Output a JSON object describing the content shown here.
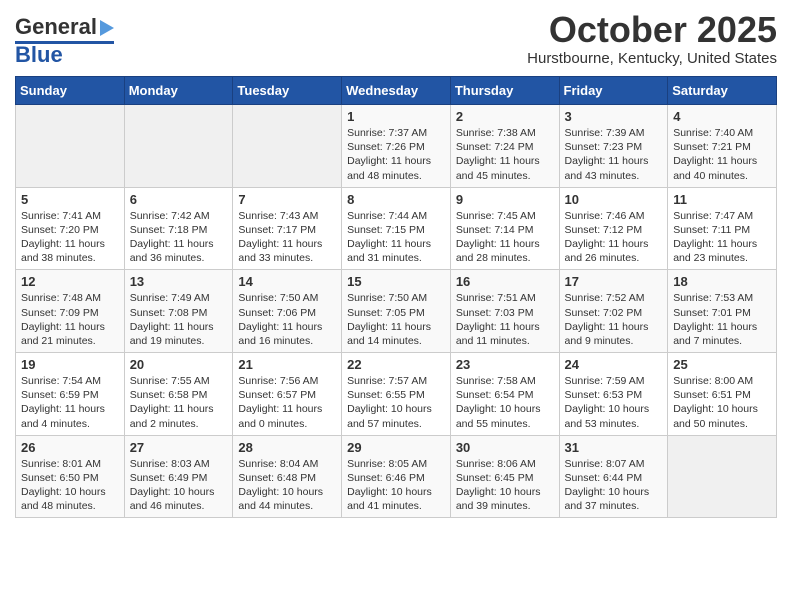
{
  "header": {
    "logo_general": "General",
    "logo_blue": "Blue",
    "month_title": "October 2025",
    "location": "Hurstbourne, Kentucky, United States"
  },
  "days_of_week": [
    "Sunday",
    "Monday",
    "Tuesday",
    "Wednesday",
    "Thursday",
    "Friday",
    "Saturday"
  ],
  "weeks": [
    [
      {
        "day": "",
        "info": ""
      },
      {
        "day": "",
        "info": ""
      },
      {
        "day": "",
        "info": ""
      },
      {
        "day": "1",
        "info": "Sunrise: 7:37 AM\nSunset: 7:26 PM\nDaylight: 11 hours\nand 48 minutes."
      },
      {
        "day": "2",
        "info": "Sunrise: 7:38 AM\nSunset: 7:24 PM\nDaylight: 11 hours\nand 45 minutes."
      },
      {
        "day": "3",
        "info": "Sunrise: 7:39 AM\nSunset: 7:23 PM\nDaylight: 11 hours\nand 43 minutes."
      },
      {
        "day": "4",
        "info": "Sunrise: 7:40 AM\nSunset: 7:21 PM\nDaylight: 11 hours\nand 40 minutes."
      }
    ],
    [
      {
        "day": "5",
        "info": "Sunrise: 7:41 AM\nSunset: 7:20 PM\nDaylight: 11 hours\nand 38 minutes."
      },
      {
        "day": "6",
        "info": "Sunrise: 7:42 AM\nSunset: 7:18 PM\nDaylight: 11 hours\nand 36 minutes."
      },
      {
        "day": "7",
        "info": "Sunrise: 7:43 AM\nSunset: 7:17 PM\nDaylight: 11 hours\nand 33 minutes."
      },
      {
        "day": "8",
        "info": "Sunrise: 7:44 AM\nSunset: 7:15 PM\nDaylight: 11 hours\nand 31 minutes."
      },
      {
        "day": "9",
        "info": "Sunrise: 7:45 AM\nSunset: 7:14 PM\nDaylight: 11 hours\nand 28 minutes."
      },
      {
        "day": "10",
        "info": "Sunrise: 7:46 AM\nSunset: 7:12 PM\nDaylight: 11 hours\nand 26 minutes."
      },
      {
        "day": "11",
        "info": "Sunrise: 7:47 AM\nSunset: 7:11 PM\nDaylight: 11 hours\nand 23 minutes."
      }
    ],
    [
      {
        "day": "12",
        "info": "Sunrise: 7:48 AM\nSunset: 7:09 PM\nDaylight: 11 hours\nand 21 minutes."
      },
      {
        "day": "13",
        "info": "Sunrise: 7:49 AM\nSunset: 7:08 PM\nDaylight: 11 hours\nand 19 minutes."
      },
      {
        "day": "14",
        "info": "Sunrise: 7:50 AM\nSunset: 7:06 PM\nDaylight: 11 hours\nand 16 minutes."
      },
      {
        "day": "15",
        "info": "Sunrise: 7:50 AM\nSunset: 7:05 PM\nDaylight: 11 hours\nand 14 minutes."
      },
      {
        "day": "16",
        "info": "Sunrise: 7:51 AM\nSunset: 7:03 PM\nDaylight: 11 hours\nand 11 minutes."
      },
      {
        "day": "17",
        "info": "Sunrise: 7:52 AM\nSunset: 7:02 PM\nDaylight: 11 hours\nand 9 minutes."
      },
      {
        "day": "18",
        "info": "Sunrise: 7:53 AM\nSunset: 7:01 PM\nDaylight: 11 hours\nand 7 minutes."
      }
    ],
    [
      {
        "day": "19",
        "info": "Sunrise: 7:54 AM\nSunset: 6:59 PM\nDaylight: 11 hours\nand 4 minutes."
      },
      {
        "day": "20",
        "info": "Sunrise: 7:55 AM\nSunset: 6:58 PM\nDaylight: 11 hours\nand 2 minutes."
      },
      {
        "day": "21",
        "info": "Sunrise: 7:56 AM\nSunset: 6:57 PM\nDaylight: 11 hours\nand 0 minutes."
      },
      {
        "day": "22",
        "info": "Sunrise: 7:57 AM\nSunset: 6:55 PM\nDaylight: 10 hours\nand 57 minutes."
      },
      {
        "day": "23",
        "info": "Sunrise: 7:58 AM\nSunset: 6:54 PM\nDaylight: 10 hours\nand 55 minutes."
      },
      {
        "day": "24",
        "info": "Sunrise: 7:59 AM\nSunset: 6:53 PM\nDaylight: 10 hours\nand 53 minutes."
      },
      {
        "day": "25",
        "info": "Sunrise: 8:00 AM\nSunset: 6:51 PM\nDaylight: 10 hours\nand 50 minutes."
      }
    ],
    [
      {
        "day": "26",
        "info": "Sunrise: 8:01 AM\nSunset: 6:50 PM\nDaylight: 10 hours\nand 48 minutes."
      },
      {
        "day": "27",
        "info": "Sunrise: 8:03 AM\nSunset: 6:49 PM\nDaylight: 10 hours\nand 46 minutes."
      },
      {
        "day": "28",
        "info": "Sunrise: 8:04 AM\nSunset: 6:48 PM\nDaylight: 10 hours\nand 44 minutes."
      },
      {
        "day": "29",
        "info": "Sunrise: 8:05 AM\nSunset: 6:46 PM\nDaylight: 10 hours\nand 41 minutes."
      },
      {
        "day": "30",
        "info": "Sunrise: 8:06 AM\nSunset: 6:45 PM\nDaylight: 10 hours\nand 39 minutes."
      },
      {
        "day": "31",
        "info": "Sunrise: 8:07 AM\nSunset: 6:44 PM\nDaylight: 10 hours\nand 37 minutes."
      },
      {
        "day": "",
        "info": ""
      }
    ]
  ]
}
